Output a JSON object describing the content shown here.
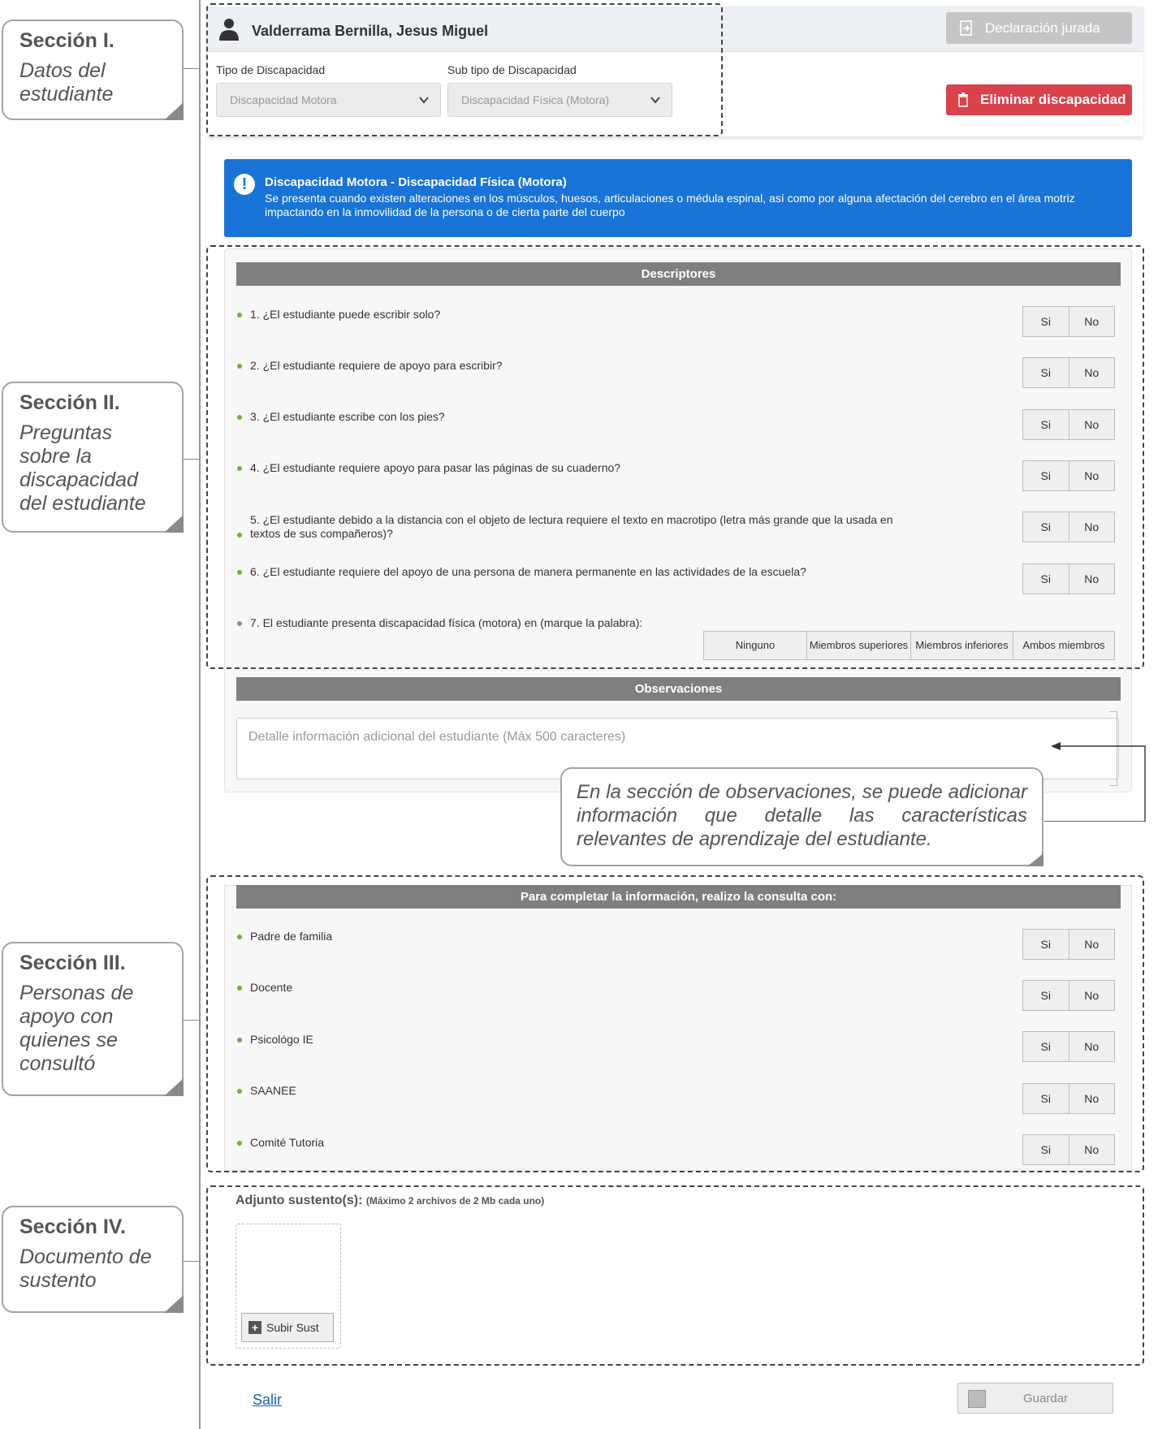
{
  "callouts": [
    {
      "title": "Sección I.",
      "desc": "Datos del estudiante"
    },
    {
      "title": "Sección II.",
      "desc": "Preguntas sobre la discapacidad del estudiante"
    },
    {
      "title": "Sección III.",
      "desc": "Personas de apoyo con quienes se consultó"
    },
    {
      "title": "Sección IV.",
      "desc": "Documento de sustento"
    }
  ],
  "student": {
    "name": "Valderrama Bernilla, Jesus Miguel",
    "declaration_button": "Declaración jurada",
    "disability_type_label": "Tipo de Discapacidad",
    "disability_type_value": "Discapacidad Motora",
    "disability_subtype_label": "Sub tipo de Discapacidad",
    "disability_subtype_value": "Discapacidad Física (Motora)",
    "delete_button": "Eliminar discapacidad"
  },
  "info": {
    "title": "Discapacidad Motora - Discapacidad Física (Motora)",
    "body": "Se presenta cuando existen alteraciones en los músculos, huesos, articulaciones o médula espinal, así como por alguna afectación del cerebro en el área motriz impactando en la inmovilidad de la persona o de cierta parte del cuerpo"
  },
  "descriptores": {
    "header": "Descriptores",
    "questions": [
      "1. ¿El estudiante puede escribir solo?",
      "2. ¿El estudiante requiere de apoyo para escribir?",
      "3. ¿El estudiante escribe con los pies?",
      "4. ¿El estudiante requiere apoyo para pasar las páginas de su cuaderno?",
      "5. ¿El estudiante debido a la distancia con el objeto de lectura requiere el texto en macrotipo (letra más grande que la usada en textos de sus compañeros)?",
      "6. ¿El estudiante requiere del apoyo de una persona de manera permanente en las actividades de la escuela?",
      "7. El estudiante presenta discapacidad física (motora) en (marque la palabra):"
    ],
    "yes": "Si",
    "no": "No",
    "options": [
      "Ninguno",
      "Miembros superiores",
      "Miembros inferiores",
      "Ambos miembros"
    ]
  },
  "observaciones": {
    "header": "Observaciones",
    "placeholder": "Detalle información adicional del estudiante (Máx 500 caracteres)"
  },
  "note": "En la sección de observaciones, se puede adicionar información que detalle las características relevantes de aprendizaje del estudiante.",
  "consulta": {
    "header": "Para completar la información, realizo la consulta con:",
    "people": [
      "Padre de familia",
      "Docente",
      "Psicológo IE",
      "SAANEE",
      "Comité Tutoria"
    ]
  },
  "adjunto": {
    "label": "Adjunto sustento(s):",
    "hint": "(Máximo 2 archivos de 2 Mb cada uno)",
    "upload_button": "Subir Sust"
  },
  "footer": {
    "exit_link": "Salir",
    "save_button": "Guardar"
  },
  "colors": {
    "info_blue": "#1a73d6",
    "danger_red": "#d9424a",
    "bullet_green": "#6ab04c",
    "bar_gray": "#7f7f7f"
  }
}
